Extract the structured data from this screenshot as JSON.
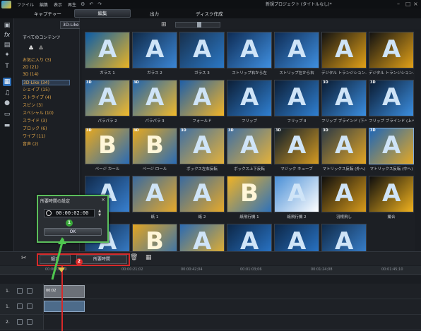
{
  "menubar": {
    "items": [
      "ファイル",
      "編集",
      "表示",
      "再生"
    ],
    "title": "新規プロジェクト (タイトルなし)*"
  },
  "modetabs": {
    "capture": "キャプチャー",
    "edit": "編集",
    "produce": "出力",
    "disc": "ディスク作成"
  },
  "library": {
    "category_select": "3D-Like",
    "all_content": "すべてのコンテンツ",
    "categories": [
      "お気に入り (3)",
      "2D (21)",
      "3D (14)",
      "3D-Like (34)",
      "シェイプ (15)",
      "ストライプ (4)",
      "スピン (3)",
      "スペシャル (10)",
      "スライド (3)",
      "ブロック (6)",
      "ワイプ (11)",
      "音声 (2)"
    ]
  },
  "effects": [
    {
      "label": "ガラス 1",
      "badge": ""
    },
    {
      "label": "ガラス 2",
      "badge": ""
    },
    {
      "label": "ガラス 3",
      "badge": ""
    },
    {
      "label": "ストリップ右から左",
      "badge": ""
    },
    {
      "label": "ストリップ左から右",
      "badge": ""
    },
    {
      "label": "デジタル トランジション…",
      "badge": ""
    },
    {
      "label": "デジタル トランジション…",
      "badge": ""
    },
    {
      "label": "パラパラ 2",
      "badge": "3D"
    },
    {
      "label": "パラパラ 3",
      "badge": "3D"
    },
    {
      "label": "フォールド",
      "badge": ""
    },
    {
      "label": "フリップ",
      "badge": ""
    },
    {
      "label": "フリップ II",
      "badge": ""
    },
    {
      "label": "フリップ ブラインド (下へ)",
      "badge": "3D"
    },
    {
      "label": "フリップ ブラインド (上へ)",
      "badge": "3D"
    },
    {
      "label": "ページ カール",
      "badge": "3D"
    },
    {
      "label": "ページ ロール",
      "badge": "3D"
    },
    {
      "label": "ボックス左右反転",
      "badge": "3D"
    },
    {
      "label": "ボックス上下反転",
      "badge": "3D"
    },
    {
      "label": "マジック キューブ",
      "badge": "3D"
    },
    {
      "label": "マトリックス反転 (外へ)",
      "badge": "3D"
    },
    {
      "label": "マトリックス反転 (中へ)",
      "badge": "3D"
    },
    {
      "label": "",
      "badge": ""
    },
    {
      "label": "紙 1",
      "badge": ""
    },
    {
      "label": "紙 2",
      "badge": ""
    },
    {
      "label": "紙飛行機 1",
      "badge": ""
    },
    {
      "label": "紙飛行機 2",
      "badge": ""
    },
    {
      "label": "羽根飛し",
      "badge": ""
    },
    {
      "label": "撮合",
      "badge": ""
    },
    {
      "label": "",
      "badge": ""
    },
    {
      "label": "",
      "badge": ""
    },
    {
      "label": "",
      "badge": ""
    },
    {
      "label": "",
      "badge": ""
    },
    {
      "label": "",
      "badge": ""
    },
    {
      "label": "",
      "badge": ""
    }
  ],
  "dialog": {
    "title": "所要時間の設定",
    "time": "00:00:02:00",
    "ok": "OK",
    "step": "1"
  },
  "timeline": {
    "trim": "鋸正",
    "duration": "所要時間",
    "step": "2",
    "ruler": [
      "00:00:00;00",
      "00:00:21;02",
      "00:00:42;04",
      "00:01:03;06",
      "00:01:24;08",
      "00:01:45;10"
    ],
    "tracks": [
      "1.",
      "1.",
      "2."
    ],
    "clip_label": "00:02"
  },
  "colors": {
    "accent": "#2e6fb8",
    "highlight_green": "#4fc74f",
    "highlight_red": "#d72a2a",
    "category_text": "#e4a84a"
  }
}
